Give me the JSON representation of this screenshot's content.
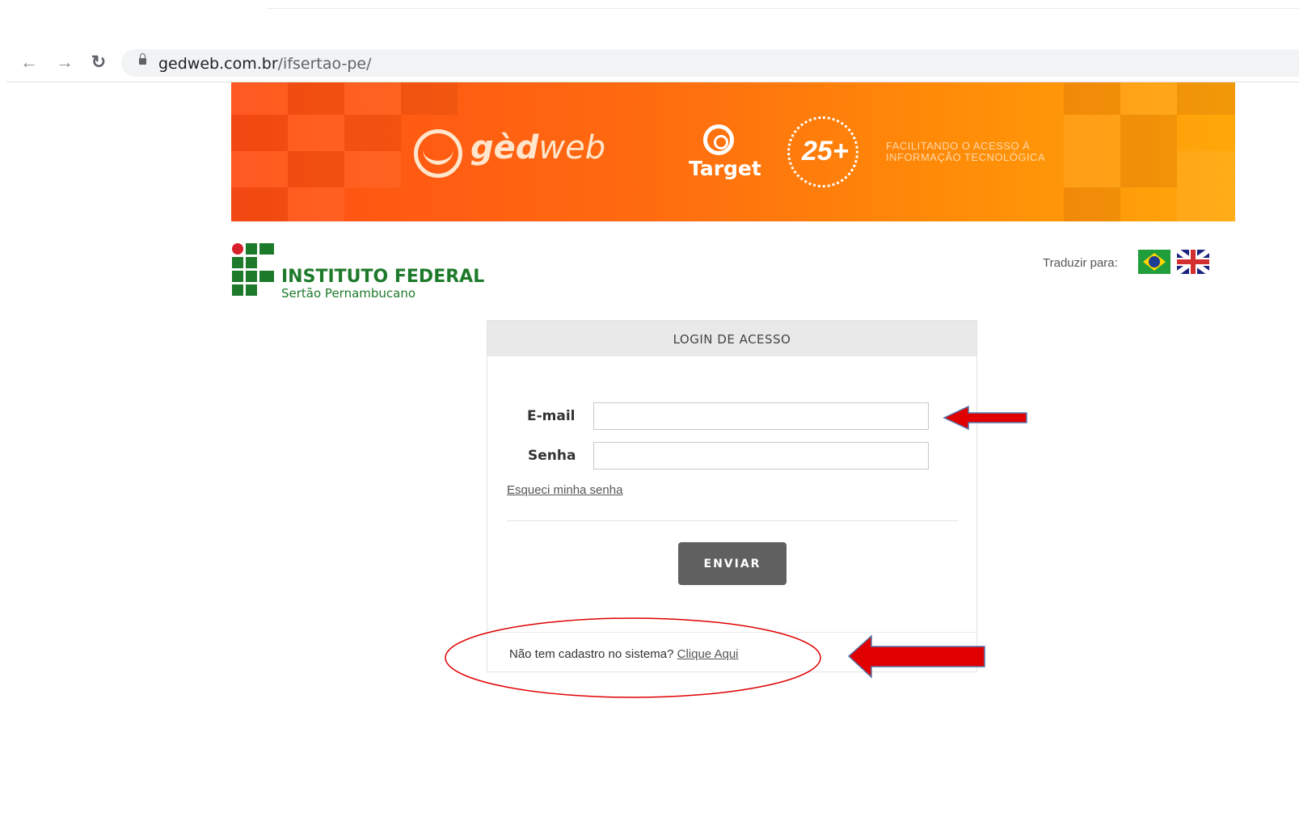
{
  "browser": {
    "url_domain": "gedweb.com.br",
    "url_path": "/ifsertao-pe/",
    "back_icon": "back-arrow-icon",
    "forward_icon": "forward-arrow-icon",
    "reload_icon": "reload-icon",
    "lock_icon": "lock-icon"
  },
  "banner": {
    "logo_prefix": "gèd",
    "logo_suffix": "web",
    "target_label": "Target",
    "seal_number": "25+",
    "tagline_line1": "FACILITANDO O ACESSO À",
    "tagline_line2": "INFORMAÇÃO TECNOLÓGICA",
    "accent_color": "#ff6a10"
  },
  "institution": {
    "name": "INSTITUTO FEDERAL",
    "campus": "Sertão Pernambucano",
    "brand_color": "#1e7a2b"
  },
  "translate": {
    "label": "Traduzir para:",
    "flags": [
      "brazil-flag-icon",
      "uk-flag-icon"
    ]
  },
  "login": {
    "title": "LOGIN DE ACESSO",
    "email_label": "E-mail",
    "email_value": "",
    "password_label": "Senha",
    "password_value": "",
    "forgot_link": "Esqueci minha senha",
    "submit_label": "ENVIAR",
    "signup_prompt": "Não tem cadastro no sistema?",
    "signup_link": "Clique Aqui"
  },
  "annotations": {
    "arrow_color": "#e00000",
    "circle_color": "#e00000"
  }
}
